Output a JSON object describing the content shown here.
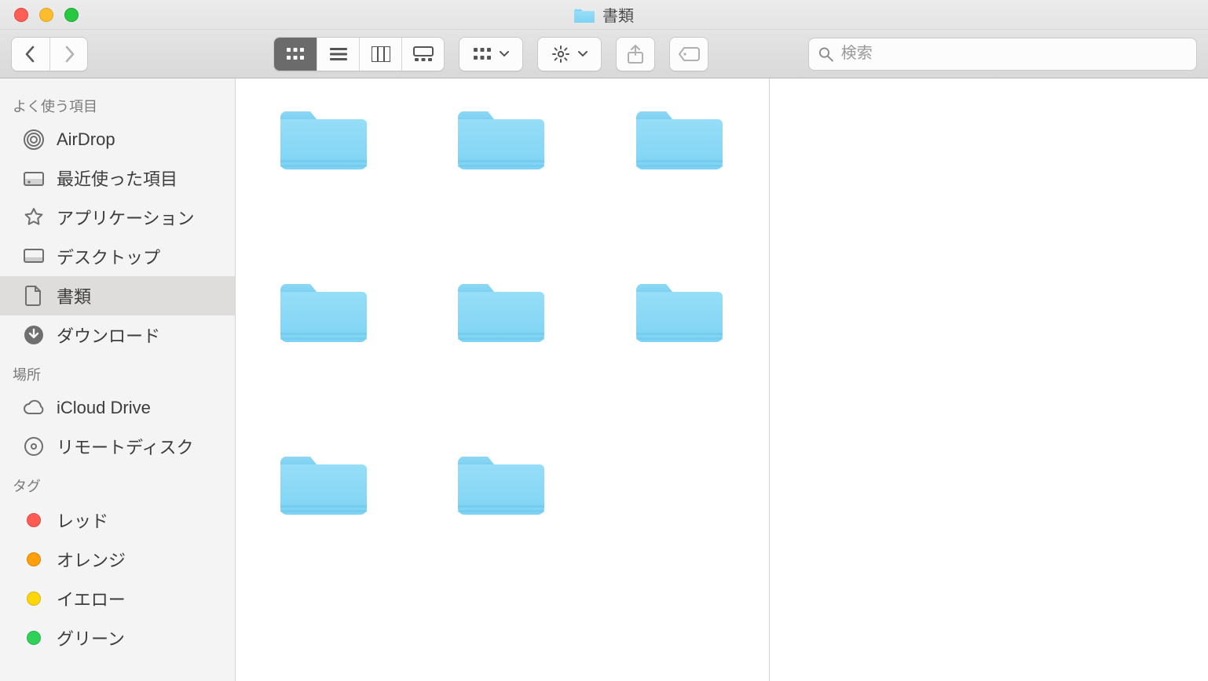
{
  "window": {
    "title": "書類"
  },
  "toolbar": {
    "search_placeholder": "検索"
  },
  "sidebar": {
    "favorites": {
      "title": "よく使う項目",
      "items": [
        {
          "icon": "airdrop",
          "label": "AirDrop"
        },
        {
          "icon": "recents",
          "label": "最近使った項目"
        },
        {
          "icon": "apps",
          "label": "アプリケーション"
        },
        {
          "icon": "desktop",
          "label": "デスクトップ"
        },
        {
          "icon": "docs",
          "label": "書類",
          "selected": true
        },
        {
          "icon": "downloads",
          "label": "ダウンロード"
        }
      ]
    },
    "locations": {
      "title": "場所",
      "items": [
        {
          "icon": "icloud",
          "label": "iCloud Drive"
        },
        {
          "icon": "disc",
          "label": "リモートディスク"
        }
      ]
    },
    "tags": {
      "title": "タグ",
      "items": [
        {
          "color": "#ff5b54",
          "label": "レッド"
        },
        {
          "color": "#ff9f0a",
          "label": "オレンジ"
        },
        {
          "color": "#ffd60a",
          "label": "イエロー"
        },
        {
          "color": "#30d158",
          "label": "グリーン"
        }
      ]
    }
  },
  "content": {
    "folders": [
      {
        "name": ""
      },
      {
        "name": ""
      },
      {
        "name": ""
      },
      {
        "name": ""
      },
      {
        "name": ""
      },
      {
        "name": ""
      },
      {
        "name": ""
      },
      {
        "name": ""
      }
    ]
  }
}
